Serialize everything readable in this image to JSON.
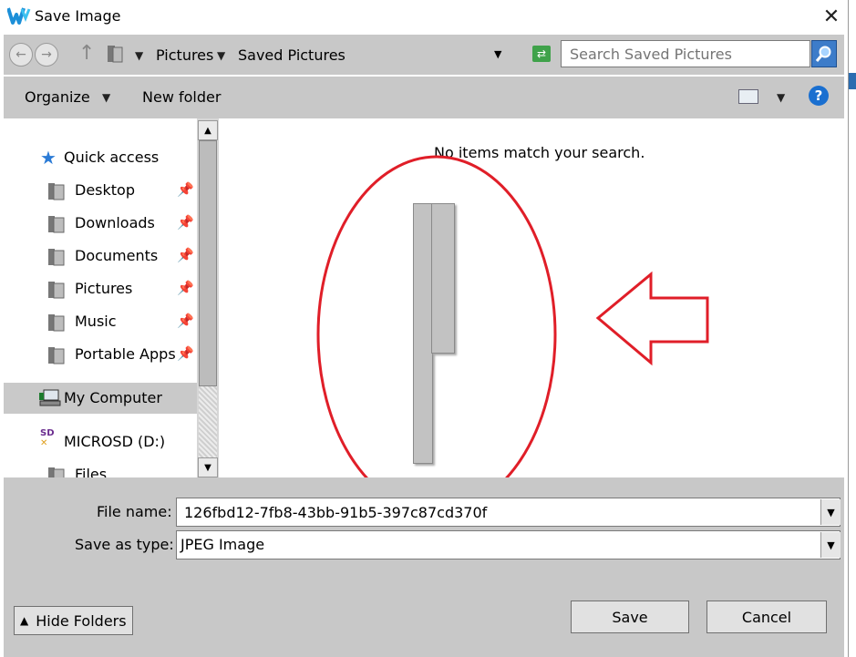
{
  "window": {
    "title": "Save Image",
    "close_symbol": "✕"
  },
  "address": {
    "crumbs": [
      "Pictures",
      "Saved Pictures"
    ]
  },
  "search": {
    "placeholder": "Search Saved Pictures",
    "value": ""
  },
  "toolbar": {
    "organize_label": "Organize",
    "new_folder_label": "New folder",
    "help_label": "?"
  },
  "navpane": {
    "quick_access": "Quick access",
    "items": [
      {
        "label": "Desktop",
        "pinned": true
      },
      {
        "label": "Downloads",
        "pinned": true
      },
      {
        "label": "Documents",
        "pinned": true
      },
      {
        "label": "Pictures",
        "pinned": true
      },
      {
        "label": "Music",
        "pinned": true
      },
      {
        "label": "Portable Apps",
        "pinned": true
      }
    ],
    "my_computer": "My Computer",
    "drive": {
      "label": "MICROSD (D:)",
      "icon_text": "SD"
    },
    "files": "Files"
  },
  "content": {
    "empty_message": "No items match your search."
  },
  "form": {
    "file_name_label": "File name:",
    "file_name_value": "126fbd12-7fb8-43bb-91b5-397c87cd370f",
    "save_type_label": "Save as type:",
    "save_type_value": "JPEG Image"
  },
  "buttons": {
    "hide_folders": "Hide Folders",
    "save": "Save",
    "cancel": "Cancel"
  },
  "icons": {
    "app": "app-logo-icon",
    "folder": "folder-icon",
    "pin": "pin-icon",
    "star": "star-icon",
    "search": "search-icon",
    "refresh": "refresh-icon",
    "help": "help-icon"
  },
  "colors": {
    "annotation": "#e01e28",
    "accent": "#1a6fd0"
  }
}
